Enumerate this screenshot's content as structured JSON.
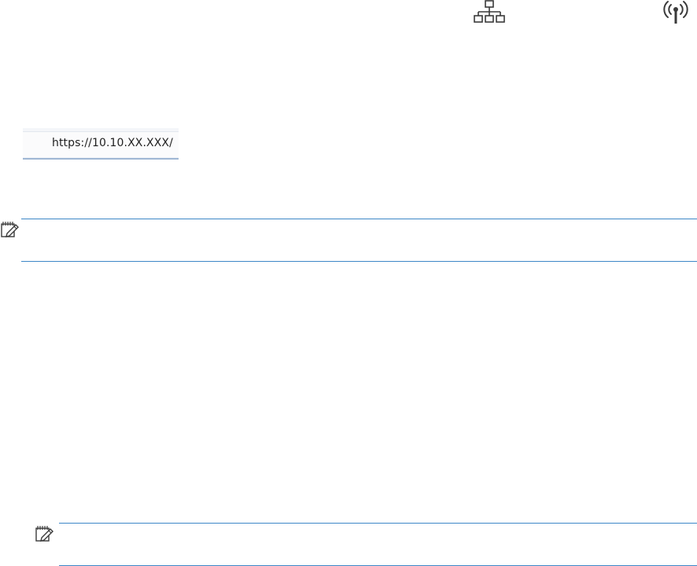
{
  "status_icons": {
    "network": "network-icon",
    "wireless": "wireless-icon"
  },
  "address_bar": {
    "url": "https://10.10.XX.XXX/"
  },
  "notes": [
    {
      "icon": "note-icon"
    },
    {
      "icon": "note-icon"
    }
  ],
  "colors": {
    "rule": "#3d87c7",
    "icon": "#3a3a3a"
  }
}
